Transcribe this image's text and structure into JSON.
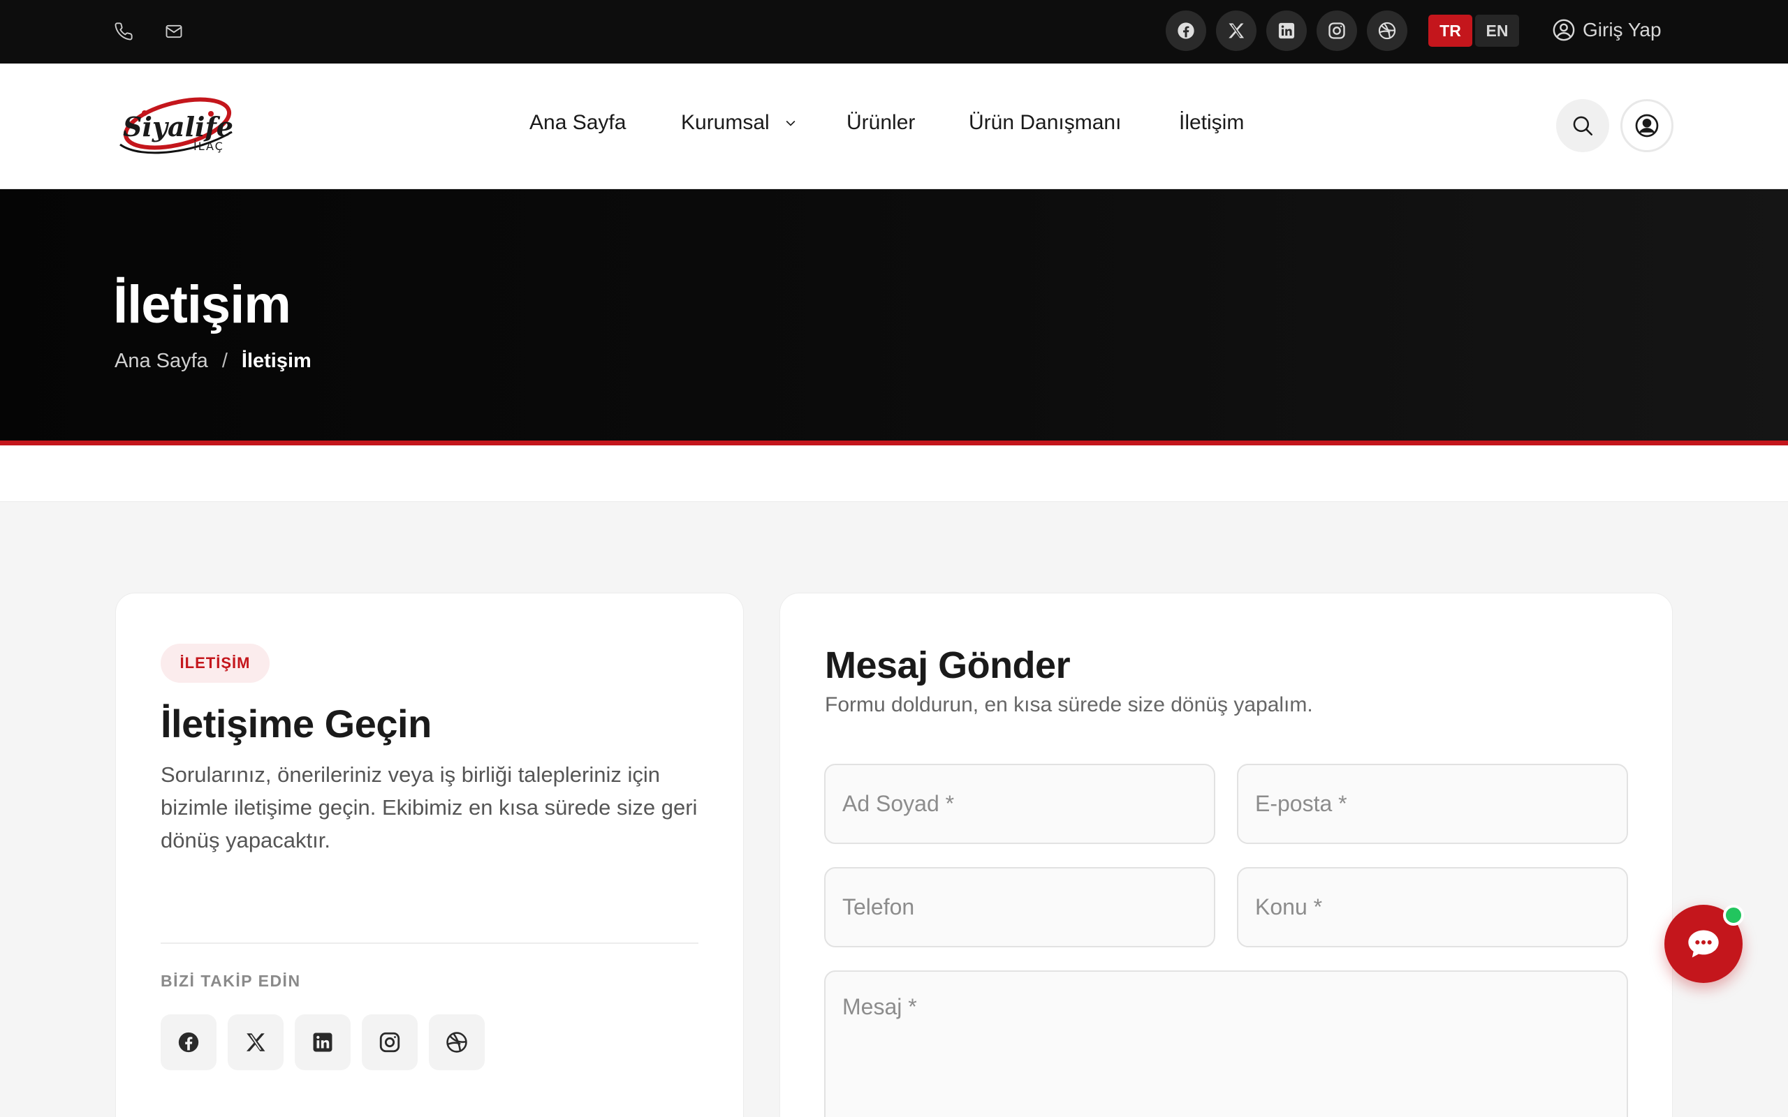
{
  "topbar": {
    "contact_icons": [
      "phone-icon",
      "mail-icon"
    ],
    "social_icons": [
      "facebook-icon",
      "x-icon",
      "linkedin-icon",
      "instagram-icon",
      "dribbble-icon"
    ],
    "languages": [
      "TR",
      "EN"
    ],
    "active_language": "TR",
    "login_label": "Giriş Yap"
  },
  "header": {
    "logo_text": "Siyalife",
    "logo_subtext": "İLAÇ",
    "nav": [
      {
        "label": "Ana Sayfa"
      },
      {
        "label": "Kurumsal",
        "has_dropdown": true
      },
      {
        "label": "Ürünler"
      },
      {
        "label": "Ürün Danışmanı"
      },
      {
        "label": "İletişim"
      }
    ]
  },
  "hero": {
    "title": "İletişim",
    "breadcrumb": [
      "Ana Sayfa",
      "İletişim"
    ],
    "separator": "/"
  },
  "contact_card": {
    "badge": "İLETİŞİM",
    "title": "İletişime Geçin",
    "description": "Sorularınız, önerileriniz veya iş birliği talepleriniz için bizimle iletişime geçin. Ekibimiz en kısa sürede size geri dönüş yapacaktır.",
    "follow_label": "BİZİ TAKİP EDİN",
    "social_icons": [
      "facebook-icon",
      "x-icon",
      "linkedin-icon",
      "instagram-icon",
      "dribbble-icon"
    ]
  },
  "form": {
    "title": "Mesaj Gönder",
    "subtitle": "Formu doldurun, en kısa sürede size dönüş yapalım.",
    "name_placeholder": "Ad Soyad *",
    "email_placeholder": "E-posta *",
    "phone_placeholder": "Telefon",
    "subject_placeholder": "Konu *",
    "message_placeholder": "Mesaj *"
  },
  "colors": {
    "accent": "#c4161c",
    "dark": "#0d0d0d",
    "online": "#22c55e"
  }
}
